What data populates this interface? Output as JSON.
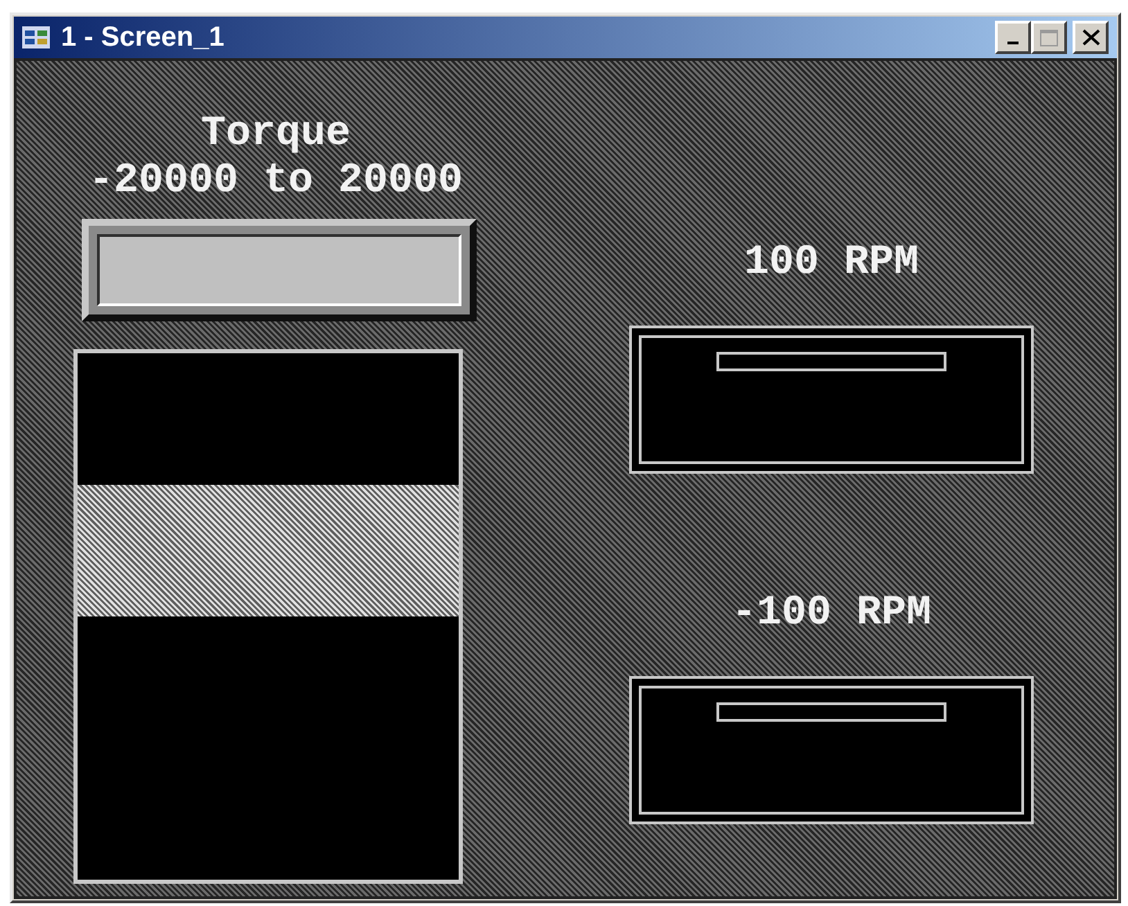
{
  "window": {
    "title": "1 - Screen_1",
    "controls": [
      {
        "kind": "minimize",
        "disabled": false
      },
      {
        "kind": "maximize",
        "disabled": true
      },
      {
        "kind": "close",
        "disabled": false
      }
    ]
  },
  "torque": {
    "title": "Torque",
    "range": "-20000 to 20000"
  },
  "buttons": [
    {
      "label": "100 RPM"
    },
    {
      "label": "-100 RPM"
    }
  ]
}
